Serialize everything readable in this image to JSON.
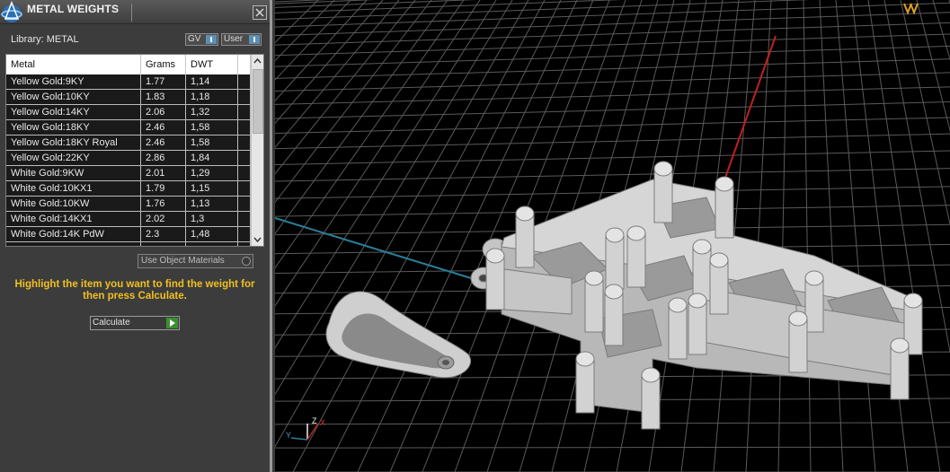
{
  "panel": {
    "title": "METAL WEIGHTS",
    "library_label": "Library: METAL",
    "toggles": {
      "gv": "GV",
      "user": "User"
    },
    "table": {
      "columns": [
        "Metal",
        "Grams",
        "DWT"
      ],
      "rows": [
        {
          "metal": "Yellow Gold:9KY",
          "grams": "1.77",
          "dwt": "1,14"
        },
        {
          "metal": "Yellow Gold:10KY",
          "grams": "1.83",
          "dwt": "1,18"
        },
        {
          "metal": "Yellow Gold:14KY",
          "grams": "2.06",
          "dwt": "1,32"
        },
        {
          "metal": "Yellow Gold:18KY",
          "grams": "2.46",
          "dwt": "1,58"
        },
        {
          "metal": "Yellow Gold:18KY Royal",
          "grams": "2.46",
          "dwt": "1,58"
        },
        {
          "metal": "Yellow Gold:22KY",
          "grams": "2.86",
          "dwt": "1,84"
        },
        {
          "metal": "White Gold:9KW",
          "grams": "2.01",
          "dwt": "1,29"
        },
        {
          "metal": "White Gold:10KX1",
          "grams": "1.79",
          "dwt": "1,15"
        },
        {
          "metal": "White Gold:10KW",
          "grams": "1.76",
          "dwt": "1,13"
        },
        {
          "metal": "White Gold:14KX1",
          "grams": "2.02",
          "dwt": "1,3"
        },
        {
          "metal": "White Gold:14K PdW",
          "grams": "2.3",
          "dwt": "1,48"
        }
      ]
    },
    "use_object_materials": "Use Object Materials",
    "hint": "Highlight the item you want to find the weight for then press Calculate.",
    "calculate_label": "Calculate"
  },
  "viewport": {
    "axis_labels": {
      "z": "Z",
      "x": "X",
      "y": "Y"
    }
  },
  "colors": {
    "hint_text": "#f0c020",
    "grid_line": "#5a5a5a",
    "x_axis": "#c02020",
    "y_axis": "#2a7f9a",
    "model": "#c8c8c8"
  }
}
